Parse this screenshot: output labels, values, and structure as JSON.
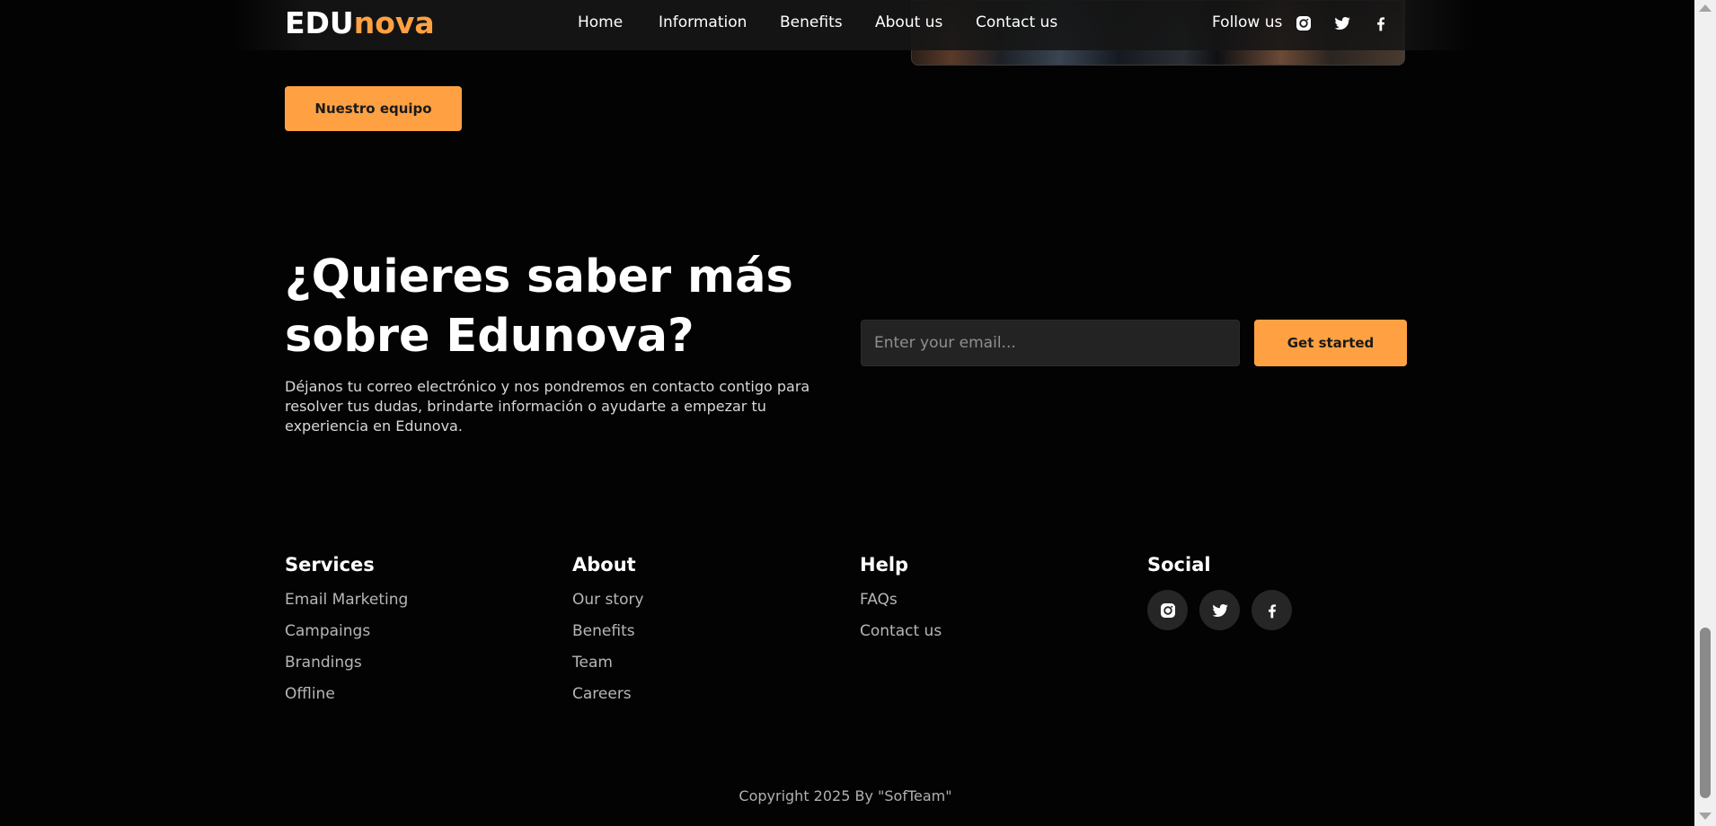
{
  "header": {
    "logo_part1": "EDU",
    "logo_part2": "nova",
    "nav": [
      {
        "label": "Home"
      },
      {
        "label": "Information"
      },
      {
        "label": "Benefits"
      },
      {
        "label": "About us"
      },
      {
        "label": "Contact us"
      }
    ],
    "follow_label": "Follow us",
    "social_icons": [
      "instagram-icon",
      "twitter-icon",
      "facebook-icon"
    ]
  },
  "team_button": {
    "label": "Nuestro equipo"
  },
  "cta": {
    "title_line1": "¿Quieres saber más",
    "title_line2": "sobre Edunova?",
    "description": "Déjanos tu correo electrónico y nos pondremos en contacto contigo para resolver tus dudas, brindarte información o ayudarte a empezar tu experiencia en Edunova.",
    "email_placeholder": "Enter your email...",
    "email_value": "",
    "button_label": "Get started"
  },
  "footer": {
    "columns": [
      {
        "heading": "Services",
        "links": [
          "Email Marketing",
          "Campaings",
          "Brandings",
          "Offline"
        ]
      },
      {
        "heading": "About",
        "links": [
          "Our story",
          "Benefits",
          "Team",
          "Careers"
        ]
      },
      {
        "heading": "Help",
        "links": [
          "FAQs",
          "Contact us"
        ]
      }
    ],
    "social": {
      "heading": "Social",
      "icons": [
        "instagram-icon",
        "twitter-icon",
        "facebook-icon"
      ]
    },
    "copyright": "Copyright 2025 By \"SofTeam\""
  },
  "colors": {
    "accent": "#ffa142",
    "background": "#030303",
    "input_bg": "#232323",
    "social_circle_bg": "#262626"
  }
}
